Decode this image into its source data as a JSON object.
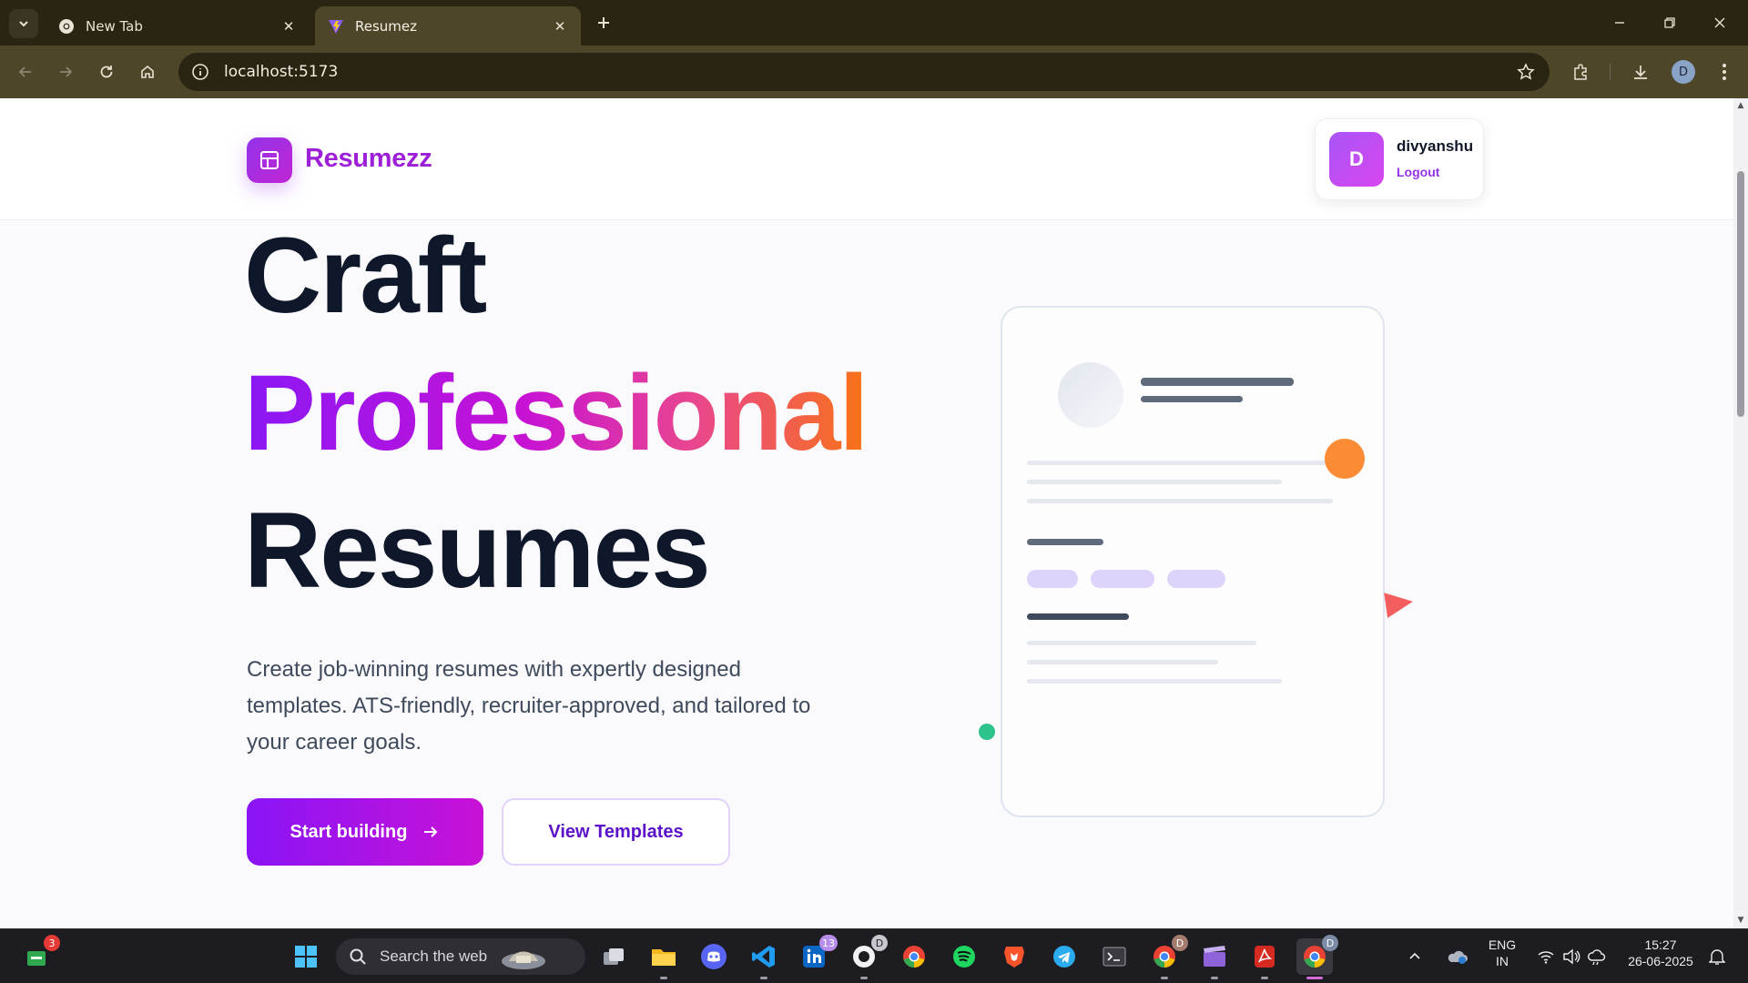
{
  "browser": {
    "tabs": [
      {
        "title": "New Tab",
        "icon": "chrome-icon",
        "active": false
      },
      {
        "title": "Resumez",
        "icon": "vite-icon",
        "active": true
      }
    ],
    "address": "localhost:5173",
    "profile_initial": "D",
    "accent_color": "#4d4629"
  },
  "site": {
    "brand": "Resumezz",
    "user": {
      "initial": "D",
      "name": "divyanshu",
      "logout_label": "Logout"
    }
  },
  "hero": {
    "line1": "Craft",
    "line2": "Professional",
    "line3": "Resumes",
    "description": "Create job-winning resumes with expertly designed templates. ATS-friendly, recruiter-approved, and tailored to your career goals.",
    "primary_cta": "Start building",
    "secondary_cta": "View Templates",
    "gradient_colors": [
      "#8b17f5",
      "#c712d4",
      "#e8468f",
      "#f97316"
    ]
  },
  "taskbar": {
    "search_placeholder": "Search the web",
    "badges": {
      "store": "3",
      "linkedin": "13",
      "github": "D",
      "chrome1": "D",
      "chrome2": "D"
    },
    "apps": [
      "windows-start",
      "search",
      "task-view",
      "file-explorer",
      "discord",
      "vscode",
      "linkedin",
      "github",
      "chrome",
      "spotify",
      "brave",
      "telegram",
      "terminal",
      "chrome-profile",
      "video-editor",
      "acrobat",
      "chrome-active"
    ],
    "language": "ENG",
    "region": "IN",
    "time": "15:27",
    "date": "26-06-2025"
  }
}
